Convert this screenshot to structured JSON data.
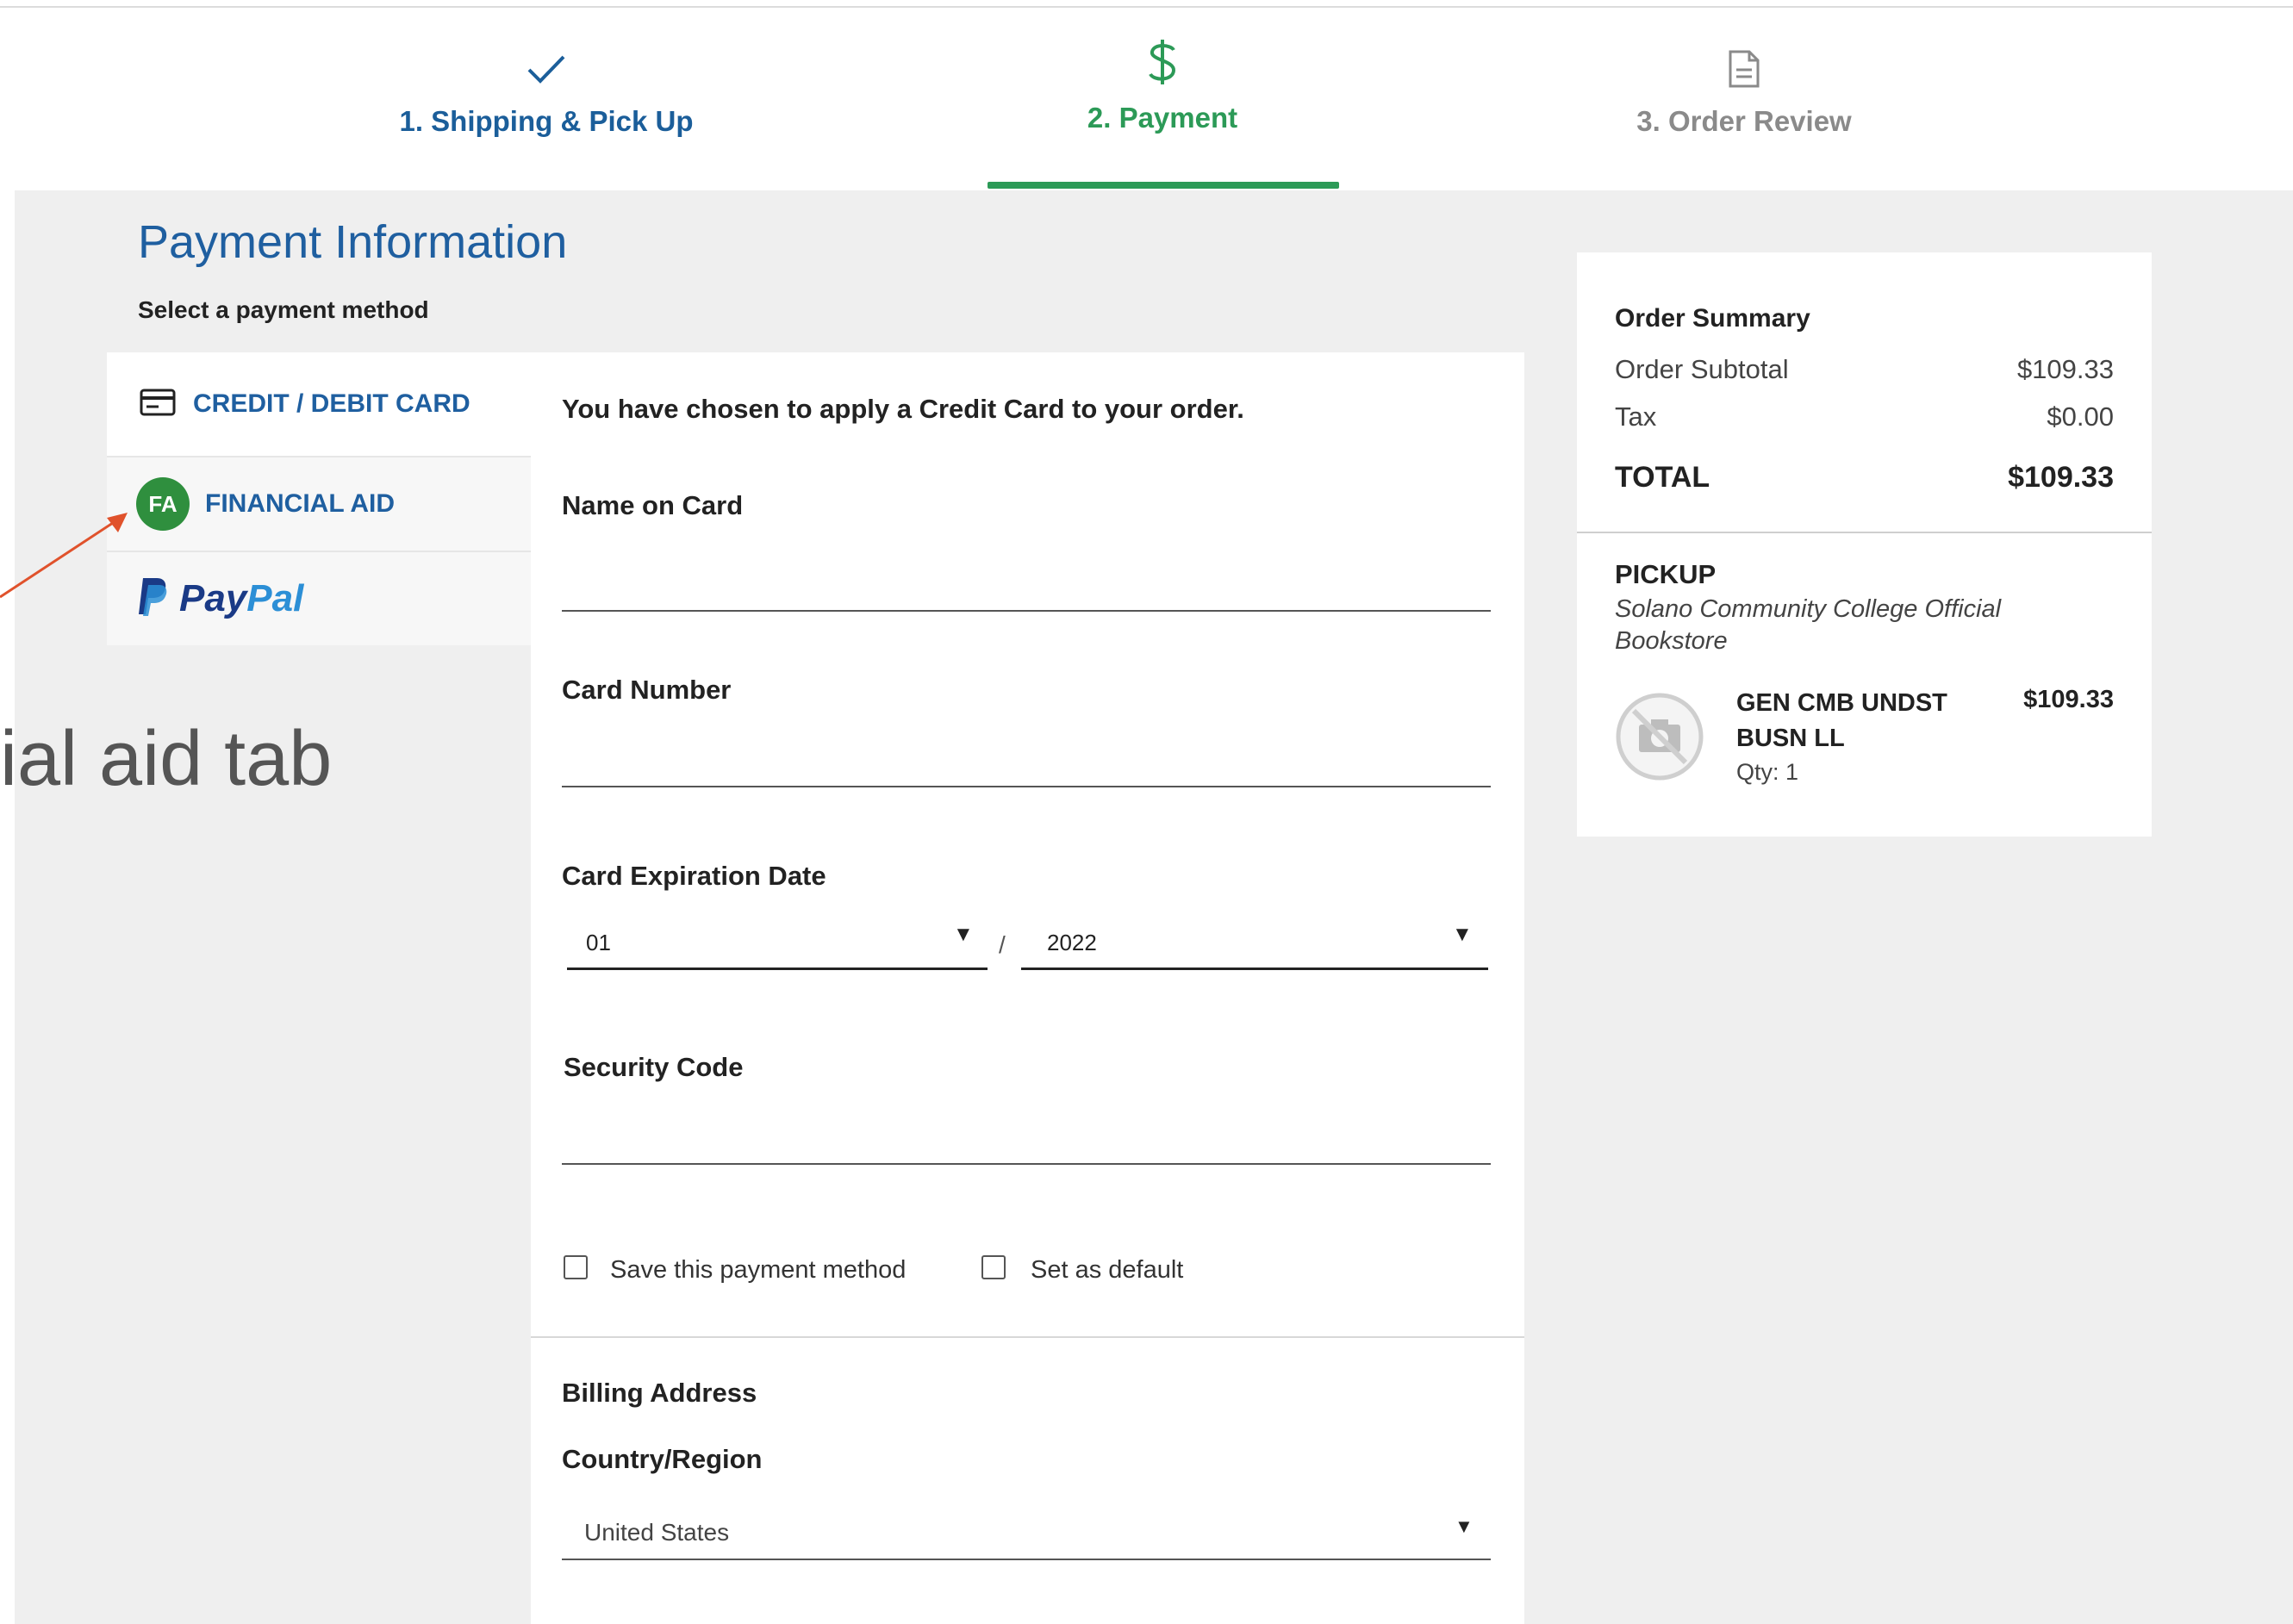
{
  "steps": [
    {
      "label": "1. Shipping & Pick Up",
      "icon": "check-icon",
      "state": "complete"
    },
    {
      "label": "2. Payment",
      "icon": "dollar-icon",
      "state": "active"
    },
    {
      "label": "3. Order Review",
      "icon": "document-icon",
      "state": "pending"
    }
  ],
  "payment": {
    "title": "Payment Information",
    "select_prompt": "Select a payment method",
    "methods": [
      {
        "label": "CREDIT / DEBIT CARD",
        "icon": "credit-card-icon",
        "selected": true
      },
      {
        "label": "FINANCIAL AID",
        "icon": "financial-aid-badge",
        "badge": "FA"
      },
      {
        "label": "PayPal",
        "icon": "paypal-icon",
        "brand_parts": [
          "Pay",
          "Pal"
        ]
      }
    ]
  },
  "form": {
    "intro": "You have chosen to apply a Credit Card to your order.",
    "name_label": "Name on Card",
    "name_value": "",
    "card_number_label": "Card Number",
    "card_number_value": "",
    "expiration_label": "Card Expiration Date",
    "exp_month": "01",
    "exp_separator": "/",
    "exp_year": "2022",
    "security_label": "Security Code",
    "security_value": "",
    "save_method_label": "Save this payment method",
    "save_method_checked": false,
    "set_default_label": "Set as default",
    "set_default_checked": false,
    "billing_label": "Billing Address",
    "country_label": "Country/Region",
    "country_value": "United States"
  },
  "summary": {
    "title": "Order Summary",
    "subtotal_label": "Order Subtotal",
    "subtotal_value": "$109.33",
    "tax_label": "Tax",
    "tax_value": "$0.00",
    "total_label": "TOTAL",
    "total_value": "$109.33",
    "pickup_title": "PICKUP",
    "pickup_location": "Solano Community College Official Bookstore",
    "item": {
      "name": "GEN CMB UNDST BUSN LL",
      "price": "$109.33",
      "qty": "Qty: 1"
    }
  },
  "annotation": {
    "text": "ial aid tab",
    "color": "#e0522c"
  },
  "colors": {
    "brand_blue": "#1f5fa0",
    "active_green": "#2c9a57",
    "page_gray": "#efefef"
  }
}
